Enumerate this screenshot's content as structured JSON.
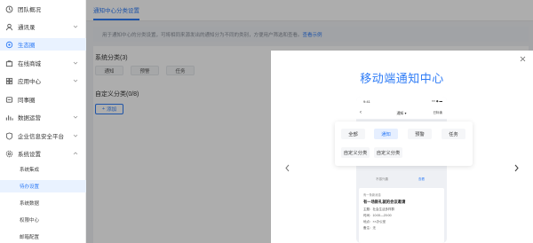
{
  "sidebar": {
    "items": [
      {
        "label": "团队概况",
        "icon": "team-overview-icon"
      },
      {
        "label": "通讯录",
        "icon": "contacts-icon"
      },
      {
        "label": "生态圈",
        "icon": "ecosystem-icon"
      },
      {
        "label": "在线商城",
        "icon": "online-store-icon"
      },
      {
        "label": "应用中心",
        "icon": "app-center-icon"
      },
      {
        "label": "同事圈",
        "icon": "colleague-circle-icon"
      },
      {
        "label": "数据运营",
        "icon": "data-operations-icon"
      },
      {
        "label": "企业信息安全平台",
        "icon": "security-platform-icon"
      },
      {
        "label": "系统设置",
        "icon": "system-settings-icon"
      }
    ],
    "subitems": [
      {
        "label": "系统集成"
      },
      {
        "label": "待办设置"
      },
      {
        "label": "系统数据"
      },
      {
        "label": "权限中心"
      },
      {
        "label": "邮箱配置"
      }
    ]
  },
  "main": {
    "tab": "通知中心分类设置",
    "description": "用于通知中心的分类设置，可将相同来源发出的通知分为不同的类别，方便用户筛选和查看。",
    "description_link": "查看示例",
    "system_section_title": "系统分类(3)",
    "system_categories": [
      "通知",
      "预警",
      "任务"
    ],
    "custom_section_title": "自定义分类(0/8)",
    "add_button": "添加"
  },
  "dialog": {
    "title": "移动端通知中心",
    "phone": {
      "time": "9:41",
      "signal": "▪▪▪ ◆ ▬",
      "back": "‹",
      "nav_title": "通知 ▾",
      "read_all": "已标读",
      "footer_left": "不感兴趣",
      "footer_right": "查看",
      "card": {
        "source": "有一条新消息",
        "title": "有一场新礼就的会议邀请",
        "lines": [
          "主题：社会生活多样群",
          "时间：10:00—20:00",
          "地点：××办公室",
          "备注：无"
        ]
      }
    },
    "popup": {
      "row1": [
        {
          "label": "全部",
          "selected": false
        },
        {
          "label": "通知",
          "selected": true
        },
        {
          "label": "预警",
          "selected": false
        },
        {
          "label": "任务",
          "selected": false
        }
      ],
      "row2": [
        {
          "label": "自定义分类",
          "selected": false
        },
        {
          "label": "自定义分类",
          "selected": false
        }
      ]
    }
  },
  "colors": {
    "accent": "#2f7cf6",
    "active_bg": "#e9f2ff",
    "overlay": "rgba(0,0,0,0.32)"
  }
}
